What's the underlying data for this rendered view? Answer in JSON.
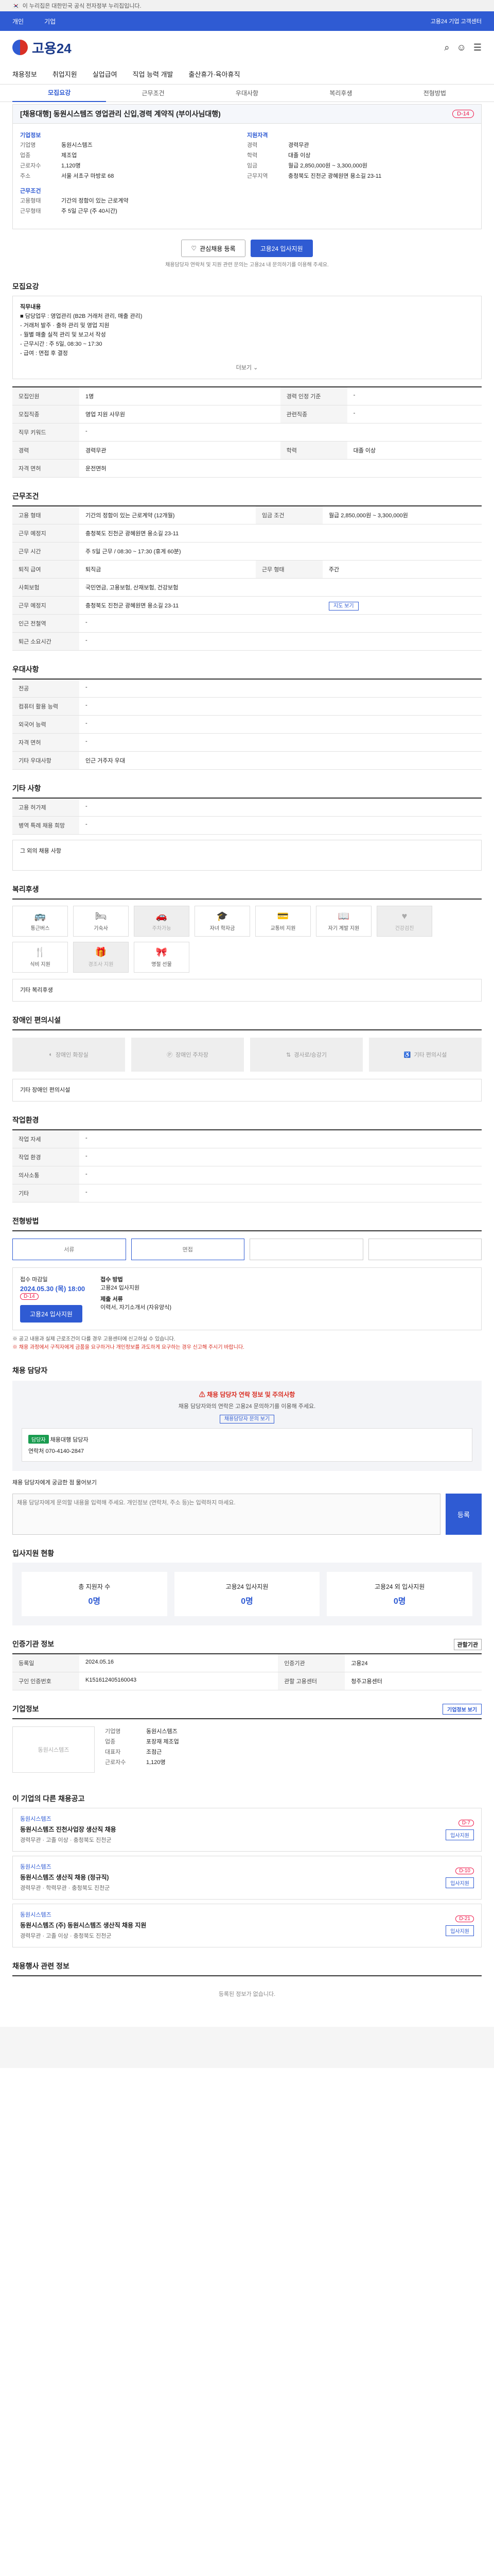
{
  "gov_banner": "이 누리집은 대한민국 공식 전자정부 누리집입니다.",
  "topnav": {
    "items": [
      "개인",
      "기업"
    ],
    "right": "고용24 기업 고객센터"
  },
  "logo": "고용24",
  "gnb": [
    "채용정보",
    "취업지원",
    "실업급여",
    "직업 능력 개발",
    "출산휴가·육아휴직"
  ],
  "subtabs": [
    "모집요강",
    "근무조건",
    "우대사항",
    "복리후생",
    "전형방법"
  ],
  "job": {
    "title": "[채용대행] 동원시스템즈 영업관리 신입,경력 계약직 (부이사님대행)",
    "badge": "D-14",
    "company_group": "기업정보",
    "company_label": "기업명",
    "company": "동원시스템즈",
    "industry_label": "업종",
    "industry": "제조업",
    "staff_label": "근로자수",
    "staff": "1,120명",
    "addr_label": "주소",
    "addr": "서울 서초구 마방로 68",
    "req_group": "지원자격",
    "career_label": "경력",
    "career": "경력무관",
    "edu_label": "학력",
    "edu": "대졸 이상",
    "cond_group": "근무조건",
    "type_label": "고용형태",
    "type": "기간의 정함이 있는 근로계약",
    "pay_label": "임금",
    "pay": "월급 2,850,000원 ~ 3,300,000원",
    "place_label": "근무지역",
    "place": "충청북도 진천군 광혜원면 용소길 23-11",
    "form_label": "근무형태",
    "form": "주 5일 근무 (주 40시간)",
    "btn_scrap": "관심채용 등록",
    "btn_apply": "고용24 입사지원",
    "apply_note": "채용담당자 연락처 및 지원 관련 문의는 고용24 내 문의하기를 이용해 주세요."
  },
  "recruit": {
    "title": "모집요강",
    "role_title": "직무내용",
    "lines": [
      "■ 담당업무 : 영업관리 (B2B 거래처 관리, 매출 관리)",
      "- 거래처 발주 · 출하 관리 및 영업 지원",
      "- 월별 매출 실적 관리 및 보고서 작성",
      "- 근무시간 : 주 5일, 08:30 ~ 17:30",
      "- 급여 : 면접 후 결정"
    ],
    "more": "더보기",
    "rows": [
      {
        "k": "모집인원",
        "v": "1명",
        "k2": "경력 인정 기준",
        "v2": "-"
      },
      {
        "k": "모집직종",
        "v": "영업 지원 사무원",
        "k2": "관련직종",
        "v2": "-"
      },
      {
        "k": "직무 키워드",
        "v": "-",
        "k2": "",
        "v2": ""
      },
      {
        "k": "경력",
        "v": "경력무관",
        "k2": "학력",
        "v2": "대졸 이상"
      },
      {
        "k": "자격 면허",
        "v": "운전면허",
        "k2": "",
        "v2": ""
      }
    ]
  },
  "work": {
    "title": "근무조건",
    "rows": [
      {
        "k": "고용 형태",
        "v": "기간의 정함이 있는 근로계약 (12개월)",
        "k2": "임금 조건",
        "v2": "월급 2,850,000원 ~ 3,300,000원"
      },
      {
        "k": "근무 예정지",
        "v": "충청북도 진천군 광혜원면 용소길 23-11",
        "k2": "",
        "v2": ""
      },
      {
        "k": "근무 시간",
        "v": "주 5일 근무 / 08:30 ~ 17:30 (휴게 60분)",
        "k2": "",
        "v2": ""
      },
      {
        "k": "퇴직 급여",
        "v": "퇴직금",
        "k2": "근무 형태",
        "v2": "주간"
      },
      {
        "k": "사회보험",
        "v": "국민연금, 고용보험, 산재보험, 건강보험",
        "k2": "",
        "v2": ""
      },
      {
        "k": "근무 예정지",
        "v": "충청북도 진천군 광혜원면 용소길 23-11",
        "k2": "",
        "v2": ""
      },
      {
        "k": "인근 전철역",
        "v": "-",
        "k2": "",
        "v2": ""
      },
      {
        "k": "퇴근 소요시간",
        "v": "-",
        "k2": "",
        "v2": ""
      }
    ],
    "map_btn": "지도 보기"
  },
  "prefer": {
    "title": "우대사항",
    "rows": [
      {
        "k": "전공",
        "v": "-"
      },
      {
        "k": "컴퓨터 활용 능력",
        "v": "-"
      },
      {
        "k": "외국어 능력",
        "v": "-"
      },
      {
        "k": "자격 면허",
        "v": "-"
      },
      {
        "k": "기타 우대사항",
        "v": "인근 거주자 우대"
      }
    ]
  },
  "etc": {
    "title": "기타 사항",
    "rows": [
      {
        "k": "고용 허가제",
        "v": "-"
      },
      {
        "k": "병역 특례 채용 희망",
        "v": "-"
      }
    ],
    "note": "그 외의 채용 사항"
  },
  "welfare": {
    "title": "복리후생",
    "cards": [
      "통근버스",
      "기숙사",
      "주차가능",
      "자녀 학자금",
      "교통비 지원",
      "자기 계발 지원",
      "건강검진",
      "식비 지원",
      "경조사 지원",
      "명절 선물"
    ],
    "other": "기타 복리후생"
  },
  "disabled": {
    "title": "장애인 편의시설",
    "cards": [
      "장애인 화장실",
      "장애인 주차장",
      "경사로/승강기",
      "기타 편의시설"
    ],
    "other": "기타 장애인 편의시설"
  },
  "worksite": {
    "title": "작업환경",
    "rows": [
      {
        "k": "작업 자세",
        "v": "-",
        "k2": "",
        "v2": ""
      },
      {
        "k": "작업 환경",
        "v": "-",
        "k2": "",
        "v2": ""
      },
      {
        "k": "의사소통",
        "v": "-",
        "k2": "",
        "v2": ""
      },
      {
        "k": "기타",
        "v": "-",
        "k2": "",
        "v2": ""
      }
    ]
  },
  "hiring": {
    "title": "전형방법",
    "steps": [
      "서류",
      "면접",
      "",
      ""
    ],
    "period_label": "접수 마감일",
    "period": "2024.05.30 (목) 18:00",
    "d_day": "D-14",
    "method_label": "접수 방법",
    "method": "고용24 입사지원",
    "doc_label": "제출 서류",
    "doc": "이력서, 자기소개서 (자유양식)",
    "apply": "고용24 입사지원"
  },
  "warnings": [
    "※ 공고 내용과 실제 근로조건이 다를 경우 고용센터에 신고하실 수 있습니다.",
    "※ 채용 과정에서 구직자에게 금품을 요구하거나 개인정보를 과도하게 요구하는 경우 신고해 주시기 바랍니다."
  ],
  "contact": {
    "title": "채용 담당자",
    "alert": "채용 담당자 연락 정보 및 주의사항",
    "sub": "채용 담당자와의 연락은 고용24 문의하기를 이용해 주세요.",
    "btn": "채용담당자 문의 보기",
    "tag": "담당자",
    "person": "채용대행 담당자",
    "phone_label": "연락처",
    "phone": "070-4140-2847"
  },
  "inquiry": {
    "title": "채용 담당자에게 궁금한 점 물어보기",
    "placeholder": "채용 담당자에게 문의할 내용을 입력해 주세요. 개인정보 (연락처, 주소 등)는 입력하지 마세요.",
    "send": "등록"
  },
  "stats": {
    "title": "입사지원 현황",
    "items": [
      {
        "k": "총 지원자 수",
        "v": "0명"
      },
      {
        "k": "고용24 입사지원",
        "v": "0명"
      },
      {
        "k": "고용24 외 입사지원",
        "v": "0명"
      }
    ]
  },
  "info": {
    "title": "인증기관 정보",
    "rows": [
      {
        "k": "등록일",
        "v": "2024.05.16",
        "k2": "인증기관",
        "v2": "고용24"
      },
      {
        "k": "구인 인증번호",
        "v": "K151612405160043",
        "k2": "관할 고용센터",
        "v2": "청주고용센터"
      }
    ],
    "select": "관할기관"
  },
  "company_info": {
    "title": "기업정보",
    "logo_text": "동원시스템즈",
    "rows": [
      {
        "k": "기업명",
        "v": "동원시스템즈"
      },
      {
        "k": "업종",
        "v": "포장재 제조업"
      },
      {
        "k": "대표자",
        "v": "조점근"
      },
      {
        "k": "근로자수",
        "v": "1,120명"
      }
    ],
    "more": "기업정보 보기"
  },
  "same_jobs": {
    "title": "이 기업의 다른 채용공고",
    "items": [
      {
        "co": "동원시스템즈",
        "title": "동원시스템즈 진천사업장 생산직 채용",
        "meta": "경력무관 · 고졸 이상 · 충청북도 진천군",
        "due": "D-7",
        "btn": "입사지원"
      },
      {
        "co": "동원시스템즈",
        "title": "동원시스템즈 생산직 채용 (정규직)",
        "meta": "경력무관 · 학력무관 · 충청북도 진천군",
        "due": "D-10",
        "btn": "입사지원"
      },
      {
        "co": "동원시스템즈",
        "title": "동원시스템즈 (주) 동원시스템즈 생산직 채용 지원",
        "meta": "경력무관 · 고졸 이상 · 충청북도 진천군",
        "due": "D-21",
        "btn": "입사지원"
      }
    ]
  },
  "empty": {
    "title": "채용행사 관련 정보",
    "text": "등록된 정보가 없습니다."
  }
}
